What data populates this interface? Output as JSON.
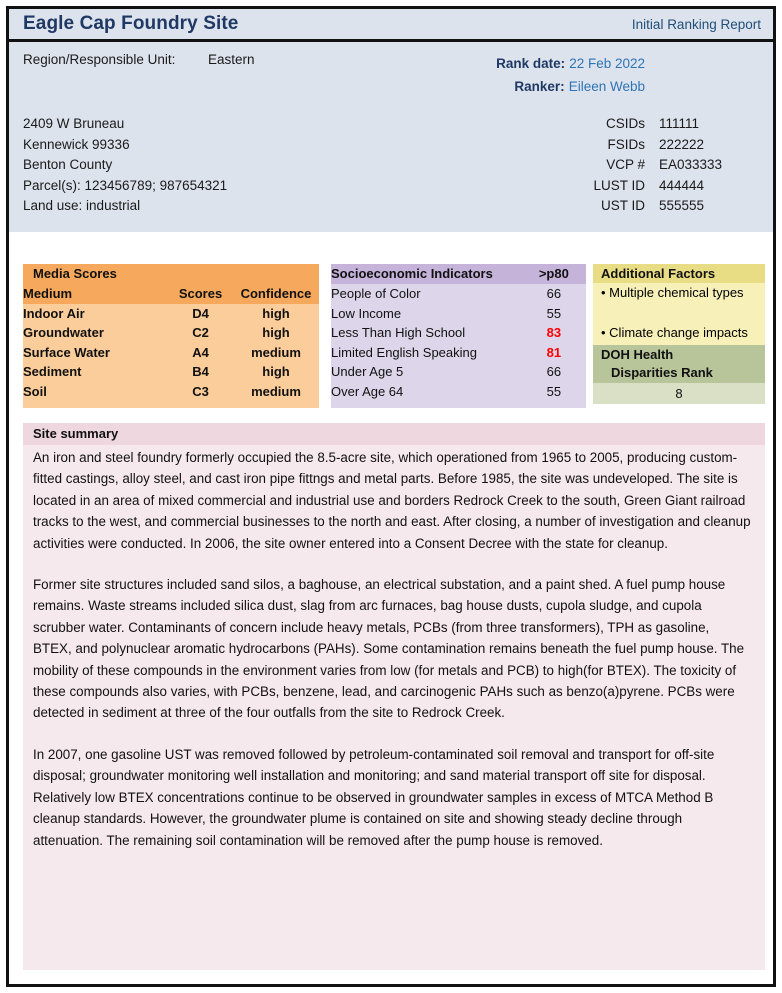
{
  "header": {
    "site_title": "Eagle Cap Foundry Site",
    "report_type": "Initial Ranking Report"
  },
  "info": {
    "region_label": "Region/Responsible Unit:",
    "region_value": "Eastern",
    "rank_date_label": "Rank date:",
    "rank_date_value": "22 Feb 2022",
    "ranker_label": "Ranker:",
    "ranker_value": "Eileen Webb",
    "address": [
      "2409 W Bruneau",
      "Kennewick  99336",
      "Benton County",
      "Parcel(s): 123456789; 987654321",
      "Land use: industrial"
    ],
    "ids": [
      {
        "key": "CSIDs",
        "value": "111111"
      },
      {
        "key": "FSIDs",
        "value": "222222"
      },
      {
        "key": "VCP #",
        "value": "EA033333"
      },
      {
        "key": "LUST ID",
        "value": "444444"
      },
      {
        "key": "UST ID",
        "value": "555555"
      }
    ]
  },
  "media_scores": {
    "title": "Media Scores",
    "columns": [
      "Medium",
      "Scores",
      "Confidence"
    ],
    "rows": [
      {
        "medium": "Indoor Air",
        "score": "D4",
        "confidence": "high"
      },
      {
        "medium": "Groundwater",
        "score": "C2",
        "confidence": "high"
      },
      {
        "medium": "Surface Water",
        "score": "A4",
        "confidence": "medium"
      },
      {
        "medium": "Sediment",
        "score": "B4",
        "confidence": "high"
      },
      {
        "medium": "Soil",
        "score": "C3",
        "confidence": "medium"
      }
    ]
  },
  "socioeconomic": {
    "title": "Socioeconomic Indicators",
    "value_header": ">p80",
    "rows": [
      {
        "name": "People of Color",
        "value": "66",
        "highlight": false
      },
      {
        "name": "Low Income",
        "value": "55",
        "highlight": false
      },
      {
        "name": "Less Than High School",
        "value": "83",
        "highlight": true
      },
      {
        "name": "Limited English Speaking",
        "value": "81",
        "highlight": true
      },
      {
        "name": "Under Age 5",
        "value": "66",
        "highlight": false
      },
      {
        "name": "Over Age 64",
        "value": "55",
        "highlight": false
      }
    ],
    "highlight_color": "#ff0000"
  },
  "additional_factors": {
    "title": "Additional Factors",
    "items": [
      "• Multiple chemical types",
      "• Climate change impacts"
    ],
    "doh_title_line1": "DOH Health",
    "doh_title_line2": "Disparities Rank",
    "doh_value": "8"
  },
  "site_summary": {
    "heading": "Site summary",
    "paragraphs": [
      "An iron and steel foundry formerly occupied the 8.5-acre site, which operationed from 1965 to 2005, producing custom-fitted castings, alloy steel, and cast iron pipe fittngs and metal parts.  Before 1985, the site was undeveloped.  The site is located in an area of mixed commercial and industrial use and borders Redrock Creek to the south, Green Giant railroad tracks to the west, and commercial businesses to the north and east.  After closing, a number of investigation and cleanup activities were conducted.  In 2006, the site owner entered into a Consent Decree with the state for cleanup.",
      "Former site structures included sand silos, a baghouse, an electrical substation, and a paint shed.  A fuel pump house remains.  Waste streams included silica dust, slag from arc furnaces, bag house dusts, cupola sludge, and cupola scrubber water.  Contaminants of concern include heavy metals, PCBs (from three transformers), TPH as gasoline, BTEX, and polynuclear aromatic hydrocarbons (PAHs).  Some contamination remains beneath the fuel pump house.  The mobility of these compounds in the environment varies from low (for metals and PCB) to high(for BTEX).  The toxicity of these compounds also varies, with PCBs, benzene, lead, and carcinogenic PAHs such as benzo(a)pyrene.  PCBs were detected in sediment at three of the four outfalls from the site to Redrock Creek.",
      " In 2007, one gasoline UST was removed followed by petroleum-contaminated soil removal and transport for off-site disposal; groundwater monitoring well installation and monitoring; and sand material transport off site for disposal. Relatively low BTEX concentrations continue to be observed in groundwater samples in excess of MTCA Method B cleanup standards.  However, the groundwater plume is contained on site and showing steady decline through attenuation.  The remaining soil contamination will be removed after the pump house is removed."
    ]
  }
}
